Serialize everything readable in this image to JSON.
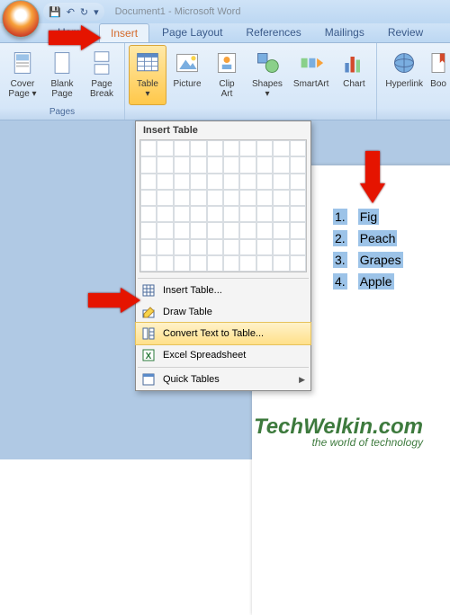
{
  "titlebar": {
    "doc_title": "Document1 - Microsoft Word"
  },
  "tabs": {
    "items": [
      "Home",
      "Insert",
      "Page Layout",
      "References",
      "Mailings",
      "Review"
    ],
    "active_index": 1
  },
  "ribbon": {
    "groups": [
      {
        "label": "Pages",
        "items": [
          {
            "name": "cover-page",
            "label1": "Cover",
            "label2": "Page",
            "dd": true
          },
          {
            "name": "blank-page",
            "label1": "Blank",
            "label2": "Page",
            "dd": false
          },
          {
            "name": "page-break",
            "label1": "Page",
            "label2": "Break",
            "dd": false
          }
        ]
      },
      {
        "label": "",
        "items": [
          {
            "name": "table",
            "label1": "Table",
            "label2": "",
            "dd": true,
            "selected": true
          },
          {
            "name": "picture",
            "label1": "Picture",
            "label2": "",
            "dd": false
          },
          {
            "name": "clipart",
            "label1": "Clip",
            "label2": "Art",
            "dd": false
          },
          {
            "name": "shapes",
            "label1": "Shapes",
            "label2": "",
            "dd": true
          },
          {
            "name": "smartart",
            "label1": "SmartArt",
            "label2": "",
            "dd": false
          },
          {
            "name": "chart",
            "label1": "Chart",
            "label2": "",
            "dd": false
          }
        ]
      },
      {
        "label": "",
        "items": [
          {
            "name": "hyperlink",
            "label1": "Hyperlink",
            "label2": "",
            "dd": false
          },
          {
            "name": "bookmark",
            "label1": "Boo",
            "label2": "",
            "dd": false
          }
        ]
      }
    ]
  },
  "dropdown": {
    "title": "Insert Table",
    "items": [
      {
        "name": "insert-table",
        "label": "Insert Table...",
        "submenu": false
      },
      {
        "name": "draw-table",
        "label": "Draw Table",
        "submenu": false
      },
      {
        "name": "convert-text",
        "label": "Convert Text to Table...",
        "submenu": false,
        "highlight": true
      },
      {
        "name": "excel-spreadsheet",
        "label": "Excel Spreadsheet",
        "submenu": false
      },
      {
        "name": "quick-tables",
        "label": "Quick Tables",
        "submenu": true
      }
    ]
  },
  "document": {
    "rows": [
      {
        "num": "1.",
        "text": "Fig"
      },
      {
        "num": "2.",
        "text": "Peach"
      },
      {
        "num": "3.",
        "text": "Grapes"
      },
      {
        "num": "4.",
        "text": "Apple"
      }
    ]
  },
  "watermark": {
    "line1": "TechWelkin.com",
    "line2": "the world of technology"
  }
}
